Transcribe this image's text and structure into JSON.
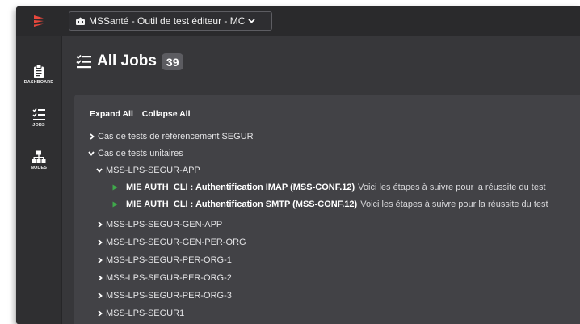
{
  "colors": {
    "brand": "#e8483d",
    "background": "#37373a",
    "panel": "#424246",
    "play": "#3fa94b",
    "badge": "#5c5c61"
  },
  "header": {
    "logo_icon": "brand-chevrons-icon",
    "project_icon": "project-icon",
    "project_name": "MSSanté - Outil de test éditeur - MC",
    "dropdown_icon": "chevron-down-icon"
  },
  "sidebar": {
    "items": [
      {
        "label": "DASHBOARD",
        "icon": "clipboard-icon"
      },
      {
        "label": "JOBS",
        "icon": "job-list-icon"
      },
      {
        "label": "NODES",
        "icon": "nodes-icon"
      }
    ]
  },
  "page": {
    "title_icon": "job-list-icon",
    "title": "All Jobs",
    "job_count": "39"
  },
  "tree": {
    "expand_all": "Expand All",
    "collapse_all": "Collapse All",
    "groups": [
      {
        "label": "Cas de tests de référencement SEGUR",
        "expanded": false
      },
      {
        "label": "Cas de tests unitaires",
        "expanded": true
      }
    ],
    "subgroups": [
      {
        "label": "MSS-LPS-SEGUR-APP",
        "expanded": true
      },
      {
        "label": "MSS-LPS-SEGUR-GEN-APP",
        "expanded": false
      },
      {
        "label": "MSS-LPS-SEGUR-GEN-PER-ORG",
        "expanded": false
      },
      {
        "label": "MSS-LPS-SEGUR-PER-ORG-1",
        "expanded": false
      },
      {
        "label": "MSS-LPS-SEGUR-PER-ORG-2",
        "expanded": false
      },
      {
        "label": "MSS-LPS-SEGUR-PER-ORG-3",
        "expanded": false
      },
      {
        "label": "MSS-LPS-SEGUR1",
        "expanded": false
      }
    ],
    "jobs": [
      {
        "title": "MIE AUTH_CLI : Authentification IMAP (MSS-CONF.12)",
        "description": "Voici les étapes à suivre pour la réussite du test"
      },
      {
        "title": "MIE AUTH_CLI : Authentification SMTP (MSS-CONF.12)",
        "description": "Voici les étapes à suivre pour la réussite du test"
      }
    ]
  }
}
